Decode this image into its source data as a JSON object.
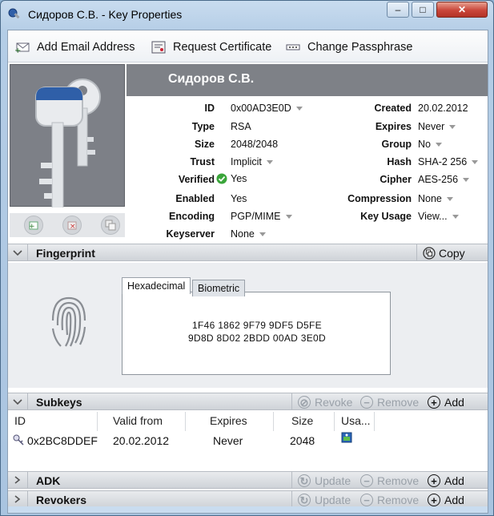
{
  "window": {
    "title": "Сидоров С.В. - Key Properties"
  },
  "toolbar": {
    "add_email": "Add Email Address",
    "request_cert": "Request Certificate",
    "change_pass": "Change Passphrase"
  },
  "header": {
    "name": "Сидоров С.В."
  },
  "props_left": [
    {
      "label": "ID",
      "value": "0x00AD3E0D",
      "dropdown": true
    },
    {
      "label": "Type",
      "value": "RSA",
      "dropdown": false
    },
    {
      "label": "Size",
      "value": "2048/2048",
      "dropdown": false
    },
    {
      "label": "Trust",
      "value": "Implicit",
      "dropdown": true
    },
    {
      "label": "Verified",
      "value": "Yes",
      "dropdown": false
    },
    {
      "label": "Enabled",
      "value": "Yes",
      "dropdown": false
    },
    {
      "label": "Encoding",
      "value": "PGP/MIME",
      "dropdown": true
    },
    {
      "label": "Keyserver",
      "value": "None",
      "dropdown": true
    }
  ],
  "props_right": [
    {
      "label": "Created",
      "value": "20.02.2012",
      "dropdown": false
    },
    {
      "label": "Expires",
      "value": "Never",
      "dropdown": true
    },
    {
      "label": "Group",
      "value": "No",
      "dropdown": true
    },
    {
      "label": "Hash",
      "value": "SHA-2 256",
      "dropdown": true
    },
    {
      "label": "Cipher",
      "value": "AES-256",
      "dropdown": true
    },
    {
      "label": "Compression",
      "value": "None",
      "dropdown": true
    },
    {
      "label": "Key Usage",
      "value": "View...",
      "dropdown": true
    }
  ],
  "fingerprint": {
    "section_title": "Fingerprint",
    "copy_label": "Copy",
    "tab_hex": "Hexadecimal",
    "tab_bio": "Biometric",
    "line1": "1F46 1862 9F79 9DF5 D5FE",
    "line2": "9D8D 8D02 2BDD 00AD 3E0D"
  },
  "subkeys": {
    "section_title": "Subkeys",
    "revoke_label": "Revoke",
    "remove_label": "Remove",
    "add_label": "Add",
    "columns": [
      "ID",
      "Valid from",
      "Expires",
      "Size",
      "Usa..."
    ],
    "rows": [
      {
        "id": "0x2BC8DDEF",
        "valid_from": "20.02.2012",
        "expires": "Never",
        "size": "2048"
      }
    ]
  },
  "adk": {
    "section_title": "ADK",
    "update_label": "Update",
    "remove_label": "Remove",
    "add_label": "Add"
  },
  "revokers": {
    "section_title": "Revokers",
    "update_label": "Update",
    "remove_label": "Remove",
    "add_label": "Add"
  },
  "colors": {
    "header_band": "#7e8187",
    "verified_green": "#3aa53a",
    "close_red": "#c9463a"
  }
}
